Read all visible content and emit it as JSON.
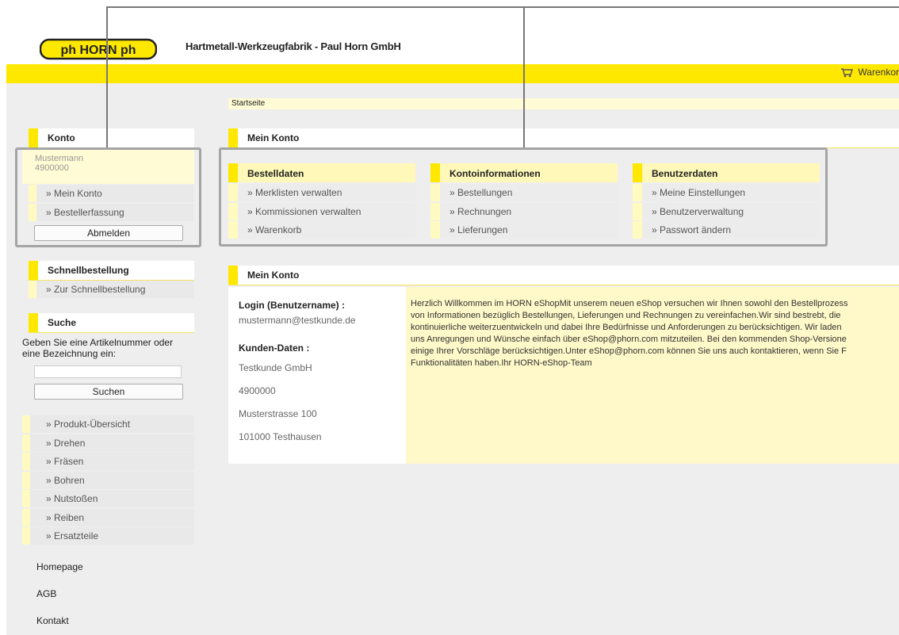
{
  "header": {
    "logo_text": "ph HORN ph",
    "company": "Hartmetall-Werkzeugfabrik - Paul Horn GmbH",
    "cart_label": "Warenkor"
  },
  "breadcrumb": "Startseite",
  "sidebar": {
    "konto": {
      "title": "Konto",
      "name": "Mustermann",
      "number": "4900000",
      "links": [
        "» Mein Konto",
        "» Bestellerfassung"
      ],
      "logout": "Abmelden"
    },
    "schnell": {
      "title": "Schnellbestellung",
      "link": "» Zur Schnellbestellung"
    },
    "suche": {
      "title": "Suche",
      "label": "Geben Sie eine Artikelnummer oder eine Bezeichnung ein:",
      "input_value": "",
      "button": "Suchen"
    },
    "categories": [
      "» Produkt-Übersicht",
      "» Drehen",
      "» Fräsen",
      "» Bohren",
      "» Nutstoßen",
      "» Reiben",
      "» Ersatzteile"
    ],
    "footer_links": [
      "Homepage",
      "AGB",
      "Kontakt"
    ]
  },
  "main": {
    "section_title": "Mein Konto",
    "columns": [
      {
        "title": "Bestelldaten",
        "items": [
          "» Merklisten verwalten",
          "» Kommissionen verwalten",
          "» Warenkorb"
        ]
      },
      {
        "title": "Kontoinformationen",
        "items": [
          "» Bestellungen",
          "» Rechnungen",
          "» Lieferungen"
        ]
      },
      {
        "title": "Benutzerdaten",
        "items": [
          "» Meine Einstellungen",
          "» Benutzerverwaltung",
          "» Passwort ändern"
        ]
      }
    ],
    "detail_title": "Mein Konto",
    "login_label": "Login (Benutzername) :",
    "login_value": "mustermann@testkunde.de",
    "kunden_label": "Kunden-Daten :",
    "kunden_values": [
      "Testkunde GmbH",
      "4900000",
      "Musterstrasse 100",
      "101000 Testhausen"
    ],
    "welcome_text": "Herzlich Willkommen im HORN eShopMit unserem neuen eShop versuchen wir Ihnen sowohl den Bestellprozess\nvon Informationen bezüglich Bestellungen, Lieferungen und Rechnungen zu vereinfachen.Wir sind bestrebt, die\nkontinuierliche weiterzuentwickeln und dabei Ihre Bedürfnisse und Anforderungen zu berücksichtigen. Wir laden\nuns Anregungen und Wünsche einfach über eShop@phorn.com mitzuteilen. Bei den kommenden Shop-Versione\neinige Ihrer Vorschläge berücksichtigen.Unter eShop@phorn.com können Sie uns auch kontaktieren, wenn Sie F\nFunktionalitäten haben.Ihr HORN-eShop-Team"
  },
  "colors": {
    "brand_yellow": "#ffe800",
    "pale_yellow": "#fffbd4",
    "highlight_gray": "#a4a4a4"
  }
}
